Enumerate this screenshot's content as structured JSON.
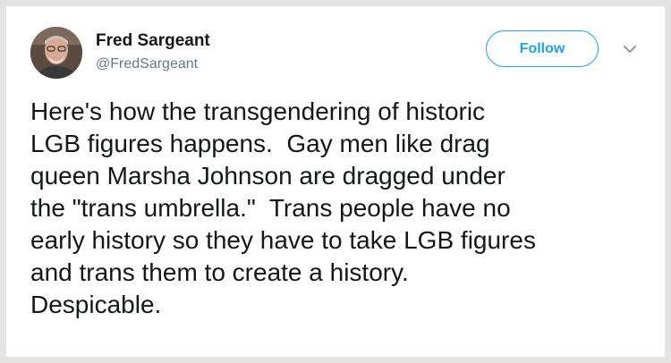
{
  "author": {
    "name": "Fred Sargeant",
    "handle": "@FredSargeant",
    "avatar": "profile-photo"
  },
  "actions": {
    "follow_label": "Follow",
    "more_icon": "chevron-down-icon"
  },
  "tweet": {
    "lines": [
      "Here's how the transgendering of historic",
      "LGB figures happens.  Gay men like drag",
      "queen Marsha Johnson are dragged under",
      "the \"trans umbrella.\"  Trans people have no",
      "early history so they have to take LGB figures",
      "and trans them to create a history.",
      "Despicable."
    ]
  },
  "colors": {
    "accent": "#1da1f2",
    "text": "#14171a",
    "secondary": "#657786",
    "background": "#e6e3e3"
  }
}
